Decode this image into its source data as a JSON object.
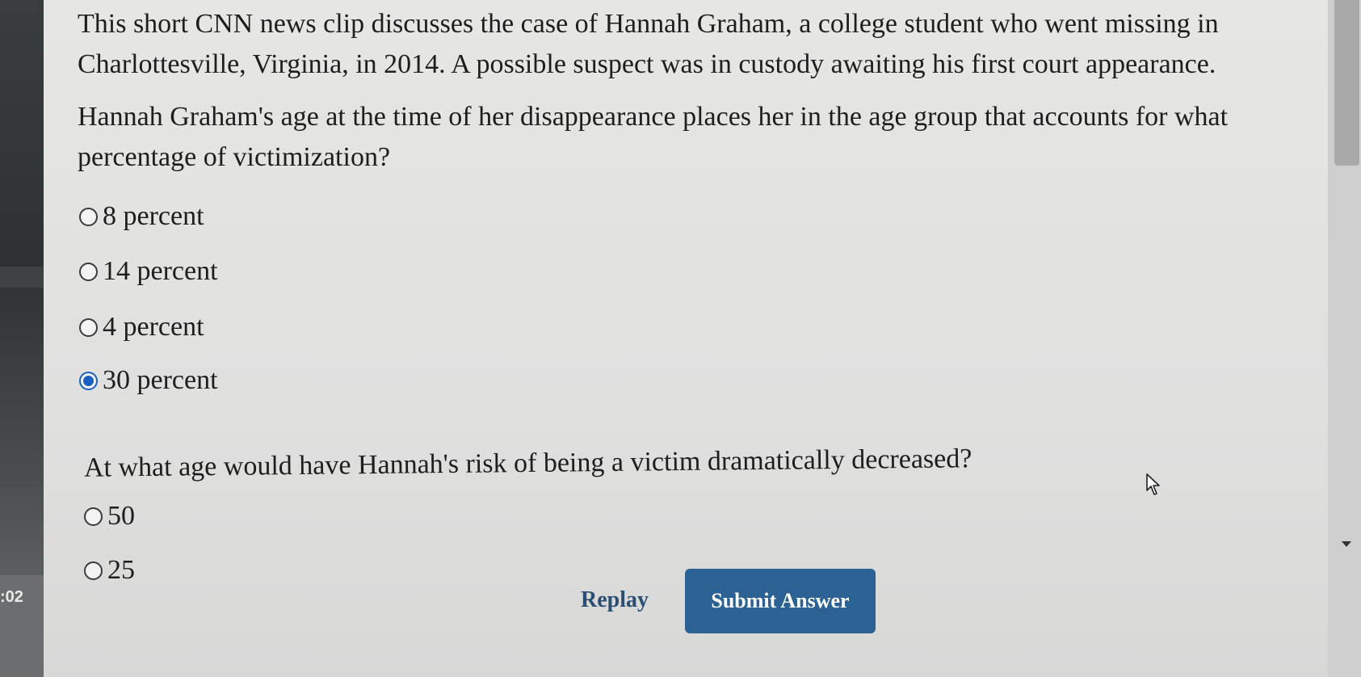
{
  "sidebar": {
    "timer": ":02"
  },
  "question1": {
    "intro": "This short CNN news clip discusses the case of Hannah Graham, a college student who went missing in Charlottesville, Virginia, in 2014. A possible suspect was in custody awaiting his first court appearance.",
    "prompt": "Hannah Graham's age at the time of her disappearance places her in the age group that accounts for what percentage of victimization?",
    "options": [
      {
        "label": "8 percent",
        "selected": false
      },
      {
        "label": "14 percent",
        "selected": false
      },
      {
        "label": "4 percent",
        "selected": false
      },
      {
        "label": "30 percent",
        "selected": true
      }
    ]
  },
  "question2": {
    "prompt": "At what age would have Hannah's risk of being a victim dramatically decreased?",
    "options": [
      {
        "label": "50",
        "selected": false
      },
      {
        "label": "25",
        "selected": false
      }
    ]
  },
  "actions": {
    "replay_label": "Replay",
    "submit_label": "Submit Answer"
  },
  "colors": {
    "accent": "#2c6193",
    "radio_selected": "#1a5fc4"
  },
  "icons": [
    "radio-icon",
    "mouse-cursor-icon",
    "scroll-down-arrow-icon"
  ]
}
